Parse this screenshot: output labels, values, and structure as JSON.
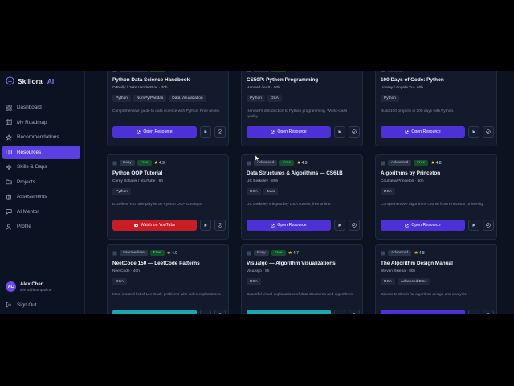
{
  "brand": {
    "name": "Skillora",
    "ai": "AI"
  },
  "nav": [
    {
      "label": "Dashboard",
      "icon": "grid-icon",
      "active": false
    },
    {
      "label": "My Roadmap",
      "icon": "map-icon",
      "active": false
    },
    {
      "label": "Recommendations",
      "icon": "star-icon",
      "active": false
    },
    {
      "label": "Resources",
      "icon": "book-icon",
      "active": true
    },
    {
      "label": "Skills & Gaps",
      "icon": "sparkle-icon",
      "active": false
    },
    {
      "label": "Projects",
      "icon": "folder-icon",
      "active": false
    },
    {
      "label": "Assessments",
      "icon": "clipboard-icon",
      "active": false
    },
    {
      "label": "AI Mentor",
      "icon": "chat-icon",
      "active": false
    },
    {
      "label": "Profile",
      "icon": "user-icon",
      "active": false
    }
  ],
  "user": {
    "initials": "AC",
    "name": "Alex Chen",
    "email": "demo@learnpath.ai"
  },
  "signout": "Sign Out",
  "cards": [
    {
      "level": "Intermediate",
      "free": "Free",
      "rating": "4.8",
      "title": "Python Data Science Handbook",
      "author": "O'Reilly / Jake VanderPlas · 30h",
      "tags": [
        "Python",
        "NumPy/Pandas",
        "Data Visualization"
      ],
      "desc": "Comprehensive guide to data science with Python. Free online.",
      "button": "Open Resource",
      "button_kind": "primary"
    },
    {
      "level": "Easy",
      "free": "Free",
      "rating": "4.9",
      "title": "CS50P: Python Programming",
      "author": "Harvard / edX · 50h",
      "tags": [
        "Python",
        "DSA"
      ],
      "desc": "Harvard's introduction to Python programming. World-class quality.",
      "button": "Open Resource",
      "button_kind": "primary"
    },
    {
      "level": "Easy",
      "free": "",
      "rating": "4.7",
      "title": "100 Days of Code: Python",
      "author": "Udemy / Angela Yu · 60h",
      "tags": [
        "Python"
      ],
      "desc": "Build 100 projects in 100 days with Python.",
      "button": "Open Resource",
      "button_kind": "primary"
    },
    {
      "level": "Easy",
      "free": "Free",
      "rating": "4.9",
      "title": "Python OOP Tutorial",
      "author": "Corey Schafer / YouTube · 6h",
      "tags": [
        "Python"
      ],
      "desc": "Excellent YouTube playlist on Python OOP concepts.",
      "button": "Watch on YouTube",
      "button_kind": "youtube"
    },
    {
      "level": "Advanced",
      "free": "Free",
      "rating": "4.9",
      "title": "Data Structures & Algorithms — CS61B",
      "author": "UC Berkeley · 80h",
      "tags": [
        "DSA",
        "Java"
      ],
      "desc": "UC Berkeley's legendary DSA course, free online.",
      "button": "Open Resource",
      "button_kind": "primary"
    },
    {
      "level": "Advanced",
      "free": "Free",
      "rating": "4.8",
      "title": "Algorithms by Princeton",
      "author": "Coursera/Princeton · 60h",
      "tags": [
        "DSA"
      ],
      "desc": "Comprehensive algorithms course from Princeton University.",
      "button": "Open Resource",
      "button_kind": "primary"
    },
    {
      "level": "Intermediate",
      "free": "Free",
      "rating": "4.9",
      "title": "NeetCode 150 — LeetCode Patterns",
      "author": "NeetCode · 40h",
      "tags": [
        "DSA"
      ],
      "desc": "Most curated list of LeetCode problems with video explanations.",
      "button": "",
      "button_kind": "teal"
    },
    {
      "level": "Easy",
      "free": "Free",
      "rating": "4.7",
      "title": "Visualgo — Algorithm Visualizations",
      "author": "VisuAlgo · 5h",
      "tags": [
        "DSA"
      ],
      "desc": "Beautiful visual explanations of data structures and algorithms.",
      "button": "",
      "button_kind": "teal"
    },
    {
      "level": "Advanced",
      "free": "",
      "rating": "4.8",
      "title": "The Algorithm Design Manual",
      "author": "Steven Skiena · 50h",
      "tags": [
        "DSA",
        "Advanced DSA"
      ],
      "desc": "Classic textbook for algorithm design and analysis.",
      "button": "",
      "button_kind": "primary"
    }
  ]
}
